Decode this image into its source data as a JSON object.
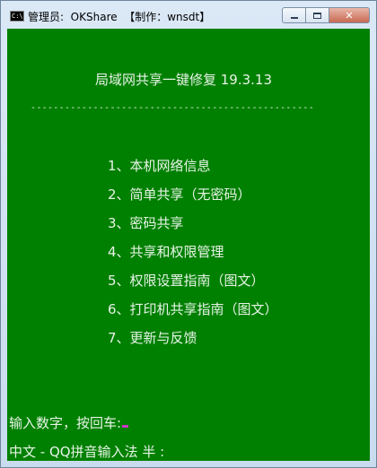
{
  "window": {
    "title": "管理员:  OKShare  【制作：wnsdt】",
    "icon_label": "C:\\"
  },
  "controls": {
    "minimize": "minimize",
    "maximize": "maximize",
    "close": "✕"
  },
  "console": {
    "heading": "局域网共享一键修复 19.3.13",
    "divider": "--------------------------------------------------",
    "menu": [
      "1、本机网络信息",
      "2、简单共享（无密码）",
      "3、密码共享",
      "4、共享和权限管理",
      "5、权限设置指南（图文）",
      "6、打印机共享指南（图文）",
      "7、更新与反馈"
    ],
    "prompt": "输入数字，按回车:",
    "ime_status": "中文 - QQ拼音输入法 半 :"
  },
  "colors": {
    "console_bg": "#008000",
    "console_fg": "#e8f3e8",
    "cursor": "#cc33cc"
  }
}
